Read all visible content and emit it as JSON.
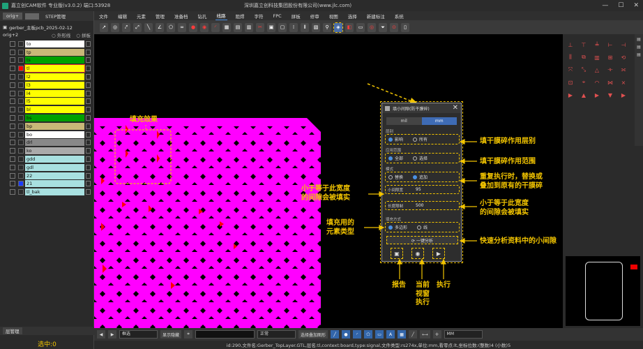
{
  "titlebar": {
    "title": "嘉立创CAM软件 专业版(v3.0.2) 端口:53928",
    "company": "深圳嘉立创科技集团股份有限公司(www.jlc.com)",
    "min": "—",
    "max": "☐",
    "close": "✕"
  },
  "leftpanel": {
    "tabs": [
      "orig+",
      "STEP管理"
    ],
    "job": "gerber_主板pcb_2025-02-12",
    "step": "orig+2",
    "outer": "外形线",
    "panel": "拼板",
    "layers": [
      {
        "name": "to",
        "color": "#ffffff"
      },
      {
        "name": "tp",
        "color": "#c8b878"
      },
      {
        "name": "ts",
        "color": "#00a000"
      },
      {
        "name": "tl",
        "color": "#ffff00"
      },
      {
        "name": "l2",
        "color": "#ffff00"
      },
      {
        "name": "l3",
        "color": "#ffff00"
      },
      {
        "name": "l4",
        "color": "#ffff00"
      },
      {
        "name": "l5",
        "color": "#ffff00"
      },
      {
        "name": "bl",
        "color": "#ffff00"
      },
      {
        "name": "bs",
        "color": "#00a000"
      },
      {
        "name": "bp",
        "color": "#c8b878"
      },
      {
        "name": "bo",
        "color": "#ffffff"
      },
      {
        "name": "drl",
        "color": "#888888"
      },
      {
        "name": "ko",
        "color": "#aaaaaa"
      },
      {
        "name": "gdd",
        "color": "#a8e0e0"
      },
      {
        "name": "gdl",
        "color": "#a8e0e0"
      },
      {
        "name": "22",
        "color": "#a8e0e0"
      },
      {
        "name": "21",
        "color": "#a8e0e0"
      },
      {
        "name": "tl_bak",
        "color": "#a8e0e0"
      }
    ],
    "bottom_tab": "层管理",
    "status": "选中:0"
  },
  "menu": [
    "文件",
    "编辑",
    "元素",
    "管理",
    "准备档",
    "钻孔",
    "线路",
    "阻焊",
    "字符",
    "FPC",
    "拼板",
    "修审",
    "视图",
    "选择",
    "新建标注",
    "系统"
  ],
  "dialog": {
    "title": "填小间隙(防干膜碎)",
    "close": "✕",
    "unit_mil": "mil",
    "unit_mm": "mm",
    "layer_label": "层别",
    "layer_opt1": "影响",
    "layer_opt2": "所有",
    "range_label": "应用范围",
    "range_opt1": "全部",
    "range_opt2": "选择",
    "mode_label": "模式",
    "mode_opt1": "替换",
    "mode_opt2": "追加",
    "width_label": "小间隙宽",
    "width_value": "95",
    "length_label": "长度限制",
    "length_value": "500",
    "fill_label": "填充方式",
    "fill_opt1": "多边形",
    "fill_opt2": "线",
    "analyze_btn": "⟳ 一键分析"
  },
  "notes": {
    "fill_effect": "填充效果",
    "layer": "填干膜碎作用层别",
    "range": "填干膜碎作用范围",
    "mode": "重复执行时，替换或\n叠加到原有的干膜碎",
    "width": "小于等于此宽度\n的间隙会被填实",
    "length": "小于等于此宽度\n的间隙会被填实",
    "fill_type": "填充用的\n元素类型",
    "analyze": "快速分析资料中的小间隙",
    "report": "报告",
    "view": "当前\n视窗\n执行",
    "exec": "执行"
  },
  "cmdbar": {
    "mode": "框选",
    "show_btn": "显示隐藏",
    "status": "正常",
    "select_btn": "选择叠加图形",
    "unit": "MM"
  },
  "statusbar": "id:290,文件名:Gerber_TopLayer.GTL,层名:tl,context:board,type:signal,文件类型:rs274x,单位:mm,看零点:lt,坐标位数:(整数)4 (小数)5"
}
